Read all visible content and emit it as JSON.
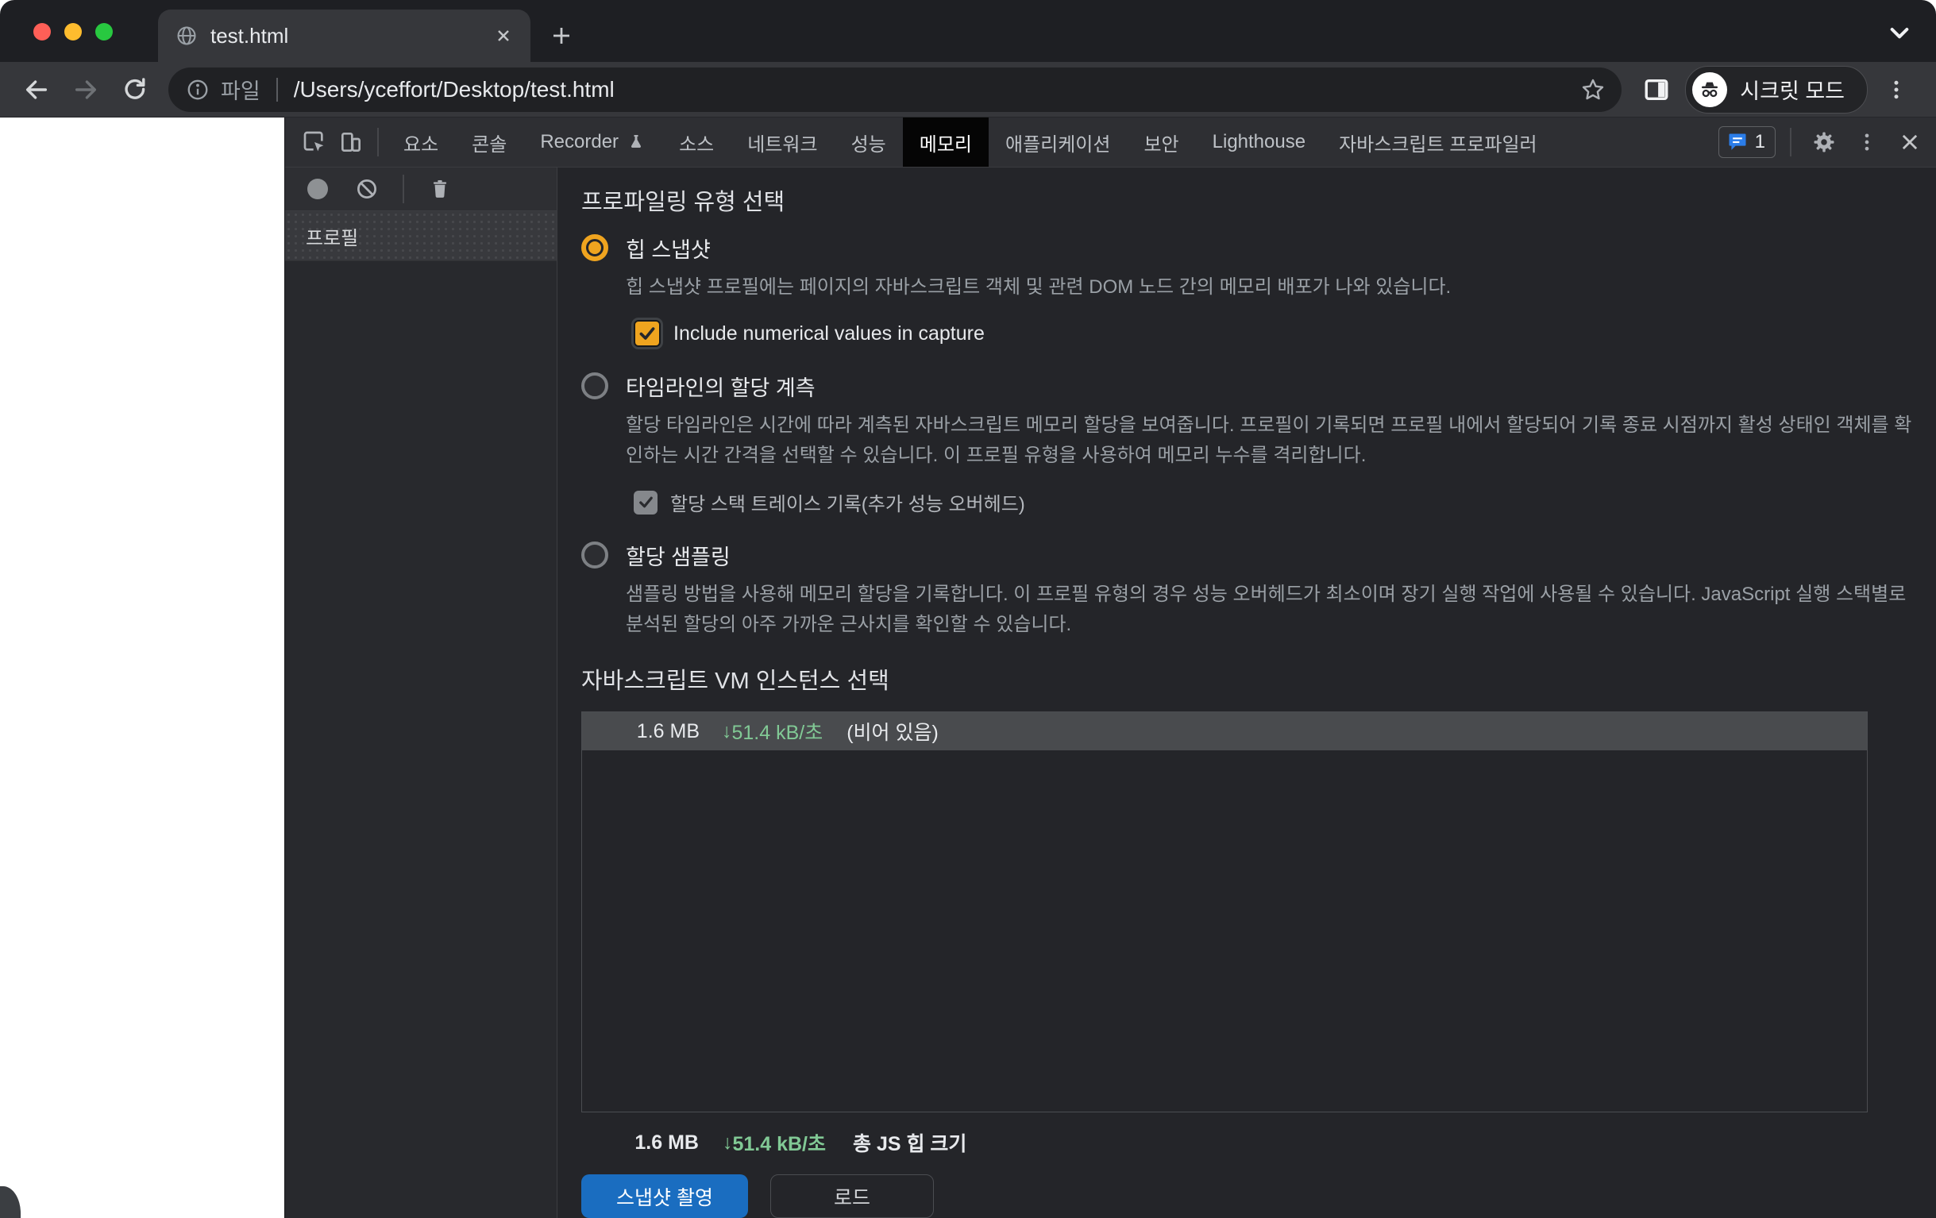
{
  "window": {
    "tab_title": "test.html",
    "toolbar": {
      "file_label": "파일",
      "url": "/Users/yceffort/Desktop/test.html",
      "incognito_label": "시크릿 모드"
    },
    "colors": {
      "traffic_red": "#ff5f57",
      "traffic_yellow": "#febc2e",
      "traffic_green": "#28c840"
    }
  },
  "devtools": {
    "tabs": [
      {
        "label": "요소"
      },
      {
        "label": "콘솔"
      },
      {
        "label": "Recorder"
      },
      {
        "label": "소스"
      },
      {
        "label": "네트워크"
      },
      {
        "label": "성능"
      },
      {
        "label": "메모리"
      },
      {
        "label": "애플리케이션"
      },
      {
        "label": "보안"
      },
      {
        "label": "Lighthouse"
      },
      {
        "label": "자바스크립트 프로파일러"
      }
    ],
    "active_tab": "메모리",
    "issues_count": "1",
    "sidebar": {
      "profiles_header": "프로필"
    },
    "memory_panel": {
      "heading": "프로파일링 유형 선택",
      "options": [
        {
          "label": "힙 스냅샷",
          "selected": true,
          "description": "힙 스냅샷 프로필에는 페이지의 자바스크립트 객체 및 관련 DOM 노드 간의 메모리 배포가 나와 있습니다.",
          "checkbox_label": "Include numerical values in capture",
          "checkbox_checked": true
        },
        {
          "label": "타임라인의 할당 계측",
          "selected": false,
          "description": "할당 타임라인은 시간에 따라 계측된 자바스크립트 메모리 할당을 보여줍니다. 프로필이 기록되면 프로필 내에서 할당되어 기록 종료 시점까지 활성 상태인 객체를 확인하는 시간 간격을 선택할 수 있습니다. 이 프로필 유형을 사용하여 메모리 누수를 격리합니다.",
          "checkbox_label": "할당 스택 트레이스 기록(추가 성능 오버헤드)",
          "checkbox_checked": true
        },
        {
          "label": "할당 샘플링",
          "selected": false,
          "description": "샘플링 방법을 사용해 메모리 할당을 기록합니다. 이 프로필 유형의 경우 성능 오버헤드가 최소이며 장기 실행 작업에 사용될 수 있습니다. JavaScript 실행 스택별로 분석된 할당의 아주 가까운 근사치를 확인할 수 있습니다."
        }
      ],
      "vm_heading": "자바스크립트 VM 인스턴스 선택",
      "vm_instance": {
        "size": "1.6 MB",
        "arrow": "↓",
        "rate": "51.4 kB/초",
        "note": "(비어 있음)"
      },
      "total": {
        "size": "1.6 MB",
        "arrow": "↓",
        "rate": "51.4 kB/초",
        "label": "총 JS 힙 크기"
      },
      "buttons": {
        "take_snapshot": "스냅샷 촬영",
        "load": "로드"
      },
      "colors": {
        "accent_orange": "#efa41f",
        "rate_green": "#81c995",
        "primary_blue": "#1a6dc0",
        "issues_blue": "#2b7de9"
      }
    }
  }
}
